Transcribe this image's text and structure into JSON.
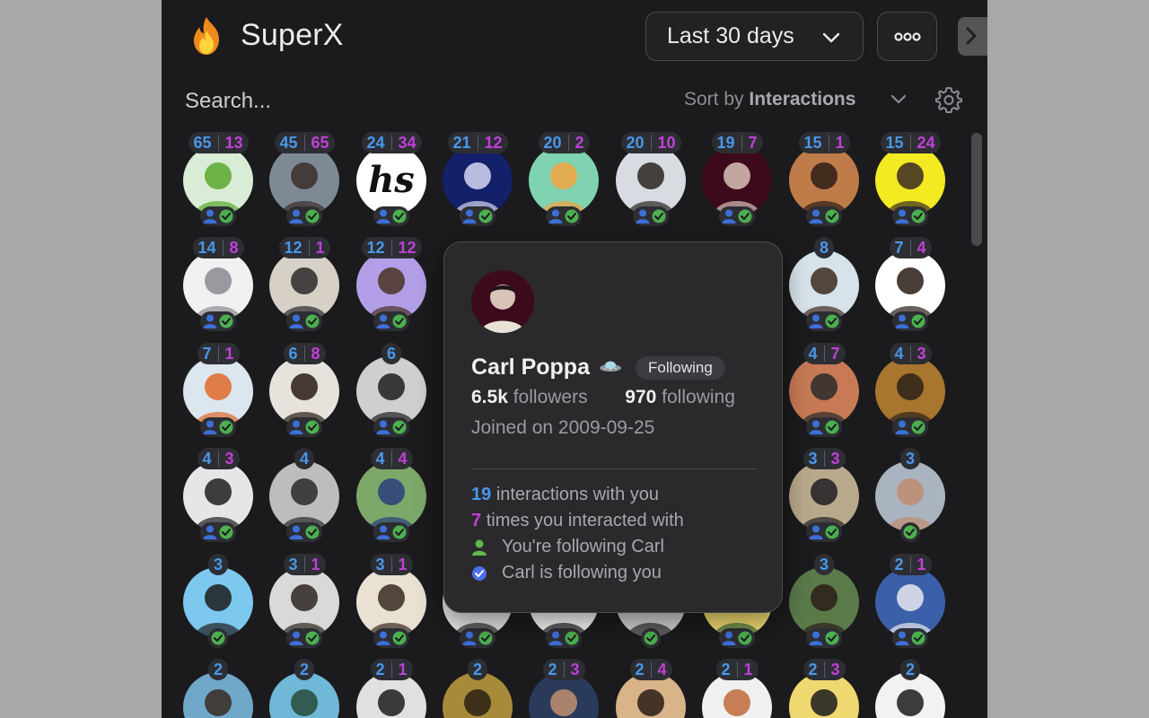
{
  "header": {
    "app_title": "SuperX",
    "date_range": "Last 30 days",
    "more_icon": "more-horizontal-icon",
    "collapse_icon": "chevron-right-icon"
  },
  "search": {
    "placeholder": "Search..."
  },
  "sort": {
    "prefix": "Sort by",
    "value": "Interactions"
  },
  "colors": {
    "background": "#1b1b1d",
    "interactions_with_you": "#4a97ea",
    "you_interacted": "#c040d8",
    "following_badge": "#4a97ea",
    "follower_badge": "#4caf50"
  },
  "users": [
    {
      "a": "65",
      "b": "13",
      "bg": "#d8ecd6",
      "fg": "#5aa82d",
      "you": true,
      "them": true
    },
    {
      "a": "45",
      "b": "65",
      "bg": "#7d8a96",
      "fg": "#3a2e2a",
      "you": true,
      "them": true
    },
    {
      "a": "24",
      "b": "34",
      "bg": "#ffffff",
      "fg": "#111111",
      "text": "hs",
      "you": true,
      "them": true
    },
    {
      "a": "21",
      "b": "12",
      "bg": "#13206a",
      "fg": "#d7d8f2",
      "you": true,
      "them": true
    },
    {
      "a": "20",
      "b": "2",
      "bg": "#7fd3b1",
      "fg": "#f2a342",
      "you": true,
      "them": true
    },
    {
      "a": "20",
      "b": "10",
      "bg": "#d8dce2",
      "fg": "#2a2520",
      "you": true,
      "them": true
    },
    {
      "a": "19",
      "b": "7",
      "bg": "#3d0a1c",
      "fg": "#d9c2b6",
      "you": true,
      "them": true
    },
    {
      "a": "15",
      "b": "1",
      "bg": "#bf7b48",
      "fg": "#2d1e18",
      "you": true,
      "them": true
    },
    {
      "a": "15",
      "b": "24",
      "bg": "#f3ea22",
      "fg": "#3a2a22",
      "you": true,
      "them": true
    },
    {
      "a": "14",
      "b": "8",
      "bg": "#f1f1f1",
      "fg": "#8a8a92",
      "you": true,
      "them": true
    },
    {
      "a": "12",
      "b": "1",
      "bg": "#d6d0c6",
      "fg": "#2a2a2a",
      "you": true,
      "them": true
    },
    {
      "a": "12",
      "b": "12",
      "bg": "#b39ee8",
      "fg": "#4a3222",
      "you": true,
      "them": true
    },
    {
      "a": "",
      "b": "",
      "bg": "#2a2a2d",
      "fg": "#2a2a2d",
      "hidden": true
    },
    {
      "a": "",
      "b": "",
      "bg": "#2a2a2d",
      "fg": "#2a2a2d",
      "hidden": true
    },
    {
      "a": "",
      "b": "",
      "bg": "#2a2a2d",
      "fg": "#2a2a2d",
      "hidden": true
    },
    {
      "a": "",
      "b": "",
      "bg": "#2a2a2d",
      "fg": "#2a2a2d",
      "hidden": true
    },
    {
      "a": "8",
      "b": "",
      "bg": "#d7e3ea",
      "fg": "#3d2a20",
      "you": true,
      "them": true
    },
    {
      "a": "7",
      "b": "4",
      "bg": "#ffffff",
      "fg": "#2a1c16",
      "you": true,
      "them": true
    },
    {
      "a": "7",
      "b": "1",
      "bg": "#dbe6ee",
      "fg": "#e0682a",
      "you": true,
      "them": true
    },
    {
      "a": "6",
      "b": "8",
      "bg": "#e7e3dc",
      "fg": "#2a1c16",
      "you": true,
      "them": true
    },
    {
      "a": "6",
      "b": "",
      "bg": "#cfcfcf",
      "fg": "#1e1e1e",
      "you": true,
      "them": true
    },
    {
      "a": "",
      "b": "",
      "bg": "#2a2a2d",
      "fg": "#2a2a2d",
      "hidden": true
    },
    {
      "a": "",
      "b": "",
      "bg": "#2a2a2d",
      "fg": "#2a2a2d",
      "hidden": true
    },
    {
      "a": "",
      "b": "",
      "bg": "#2a2a2d",
      "fg": "#2a2a2d",
      "hidden": true
    },
    {
      "a": "",
      "b": "",
      "bg": "#2a2a2d",
      "fg": "#2a2a2d",
      "hidden": true
    },
    {
      "a": "4",
      "b": "7",
      "bg": "#c77a55",
      "fg": "#2a2a2a",
      "you": true,
      "them": true
    },
    {
      "a": "4",
      "b": "3",
      "bg": "#a8762e",
      "fg": "#2b2219",
      "you": true,
      "them": true
    },
    {
      "a": "4",
      "b": "3",
      "bg": "#e6e6e6",
      "fg": "#1e1e1e",
      "you": true,
      "them": true
    },
    {
      "a": "4",
      "b": "",
      "bg": "#bdbdbd",
      "fg": "#2a2a2a",
      "you": true,
      "them": true
    },
    {
      "a": "4",
      "b": "4",
      "bg": "#7ea86a",
      "fg": "#2a3e7a",
      "you": true,
      "them": true
    },
    {
      "a": "",
      "b": "",
      "bg": "#2a2a2d",
      "fg": "#2a2a2d",
      "hidden": true
    },
    {
      "a": "",
      "b": "",
      "bg": "#2a2a2d",
      "fg": "#2a2a2d",
      "hidden": true
    },
    {
      "a": "",
      "b": "",
      "bg": "#2a2a2d",
      "fg": "#2a2a2d",
      "hidden": true
    },
    {
      "a": "",
      "b": "",
      "bg": "#2a2a2d",
      "fg": "#2a2a2d",
      "hidden": true
    },
    {
      "a": "3",
      "b": "3",
      "bg": "#b9a98c",
      "fg": "#1f1f22",
      "you": true,
      "them": true
    },
    {
      "a": "3",
      "b": "",
      "bg": "#aab4c0",
      "fg": "#c08c70",
      "you": false,
      "them": true
    },
    {
      "a": "3",
      "b": "",
      "bg": "#7cc8ef",
      "fg": "#1c1c1c",
      "you": false,
      "them": true
    },
    {
      "a": "3",
      "b": "1",
      "bg": "#d9d9d9",
      "fg": "#2d2520",
      "you": true,
      "them": true
    },
    {
      "a": "3",
      "b": "1",
      "bg": "#e9e2d2",
      "fg": "#3a2a22",
      "ring": "#a23bd4",
      "you": true,
      "them": true
    },
    {
      "a": "",
      "b": "",
      "bg": "#e2e2e2",
      "fg": "#2a2a2a",
      "partial": true,
      "you": true,
      "them": true
    },
    {
      "a": "",
      "b": "",
      "bg": "#f3f3f3",
      "fg": "#1c1c1c",
      "partial": true,
      "you": true,
      "them": true
    },
    {
      "a": "",
      "b": "",
      "bg": "#cfcfcf",
      "fg": "#2a2a2a",
      "partial": true,
      "you": false,
      "them": true
    },
    {
      "a": "",
      "b": "",
      "bg": "#f0d870",
      "fg": "#3a6a3a",
      "partial": true,
      "you": true,
      "them": true
    },
    {
      "a": "3",
      "b": "",
      "bg": "#5a7a4a",
      "fg": "#2a1e18",
      "you": true,
      "them": true
    },
    {
      "a": "2",
      "b": "1",
      "bg": "#3b5fa8",
      "fg": "#e8e8f0",
      "you": true,
      "them": true
    },
    {
      "a": "2",
      "b": "",
      "bg": "#6fa8c8",
      "fg": "#3a2a22",
      "you": false,
      "them": false
    },
    {
      "a": "2",
      "b": "",
      "bg": "#6fb8d8",
      "fg": "#2a4a3a",
      "you": false,
      "them": false
    },
    {
      "a": "2",
      "b": "1",
      "bg": "#e0e0e0",
      "fg": "#1c1c1c",
      "you": false,
      "them": false
    },
    {
      "a": "2",
      "b": "",
      "bg": "#a88a3a",
      "fg": "#2a2214",
      "you": false,
      "them": false
    },
    {
      "a": "2",
      "b": "3",
      "bg": "#2a3a5a",
      "fg": "#c09070",
      "you": false,
      "them": false
    },
    {
      "a": "2",
      "b": "4",
      "bg": "#d8b488",
      "fg": "#2a1c16",
      "you": false,
      "them": false
    },
    {
      "a": "2",
      "b": "1",
      "bg": "#f0f0f0",
      "fg": "#c06a3a",
      "you": false,
      "them": false
    },
    {
      "a": "2",
      "b": "3",
      "bg": "#f0d870",
      "fg": "#1c1c1c",
      "you": false,
      "them": false
    },
    {
      "a": "2",
      "b": "",
      "bg": "#f2f2f2",
      "fg": "#1c1c1c",
      "you": false,
      "them": false
    }
  ],
  "tooltip": {
    "name": "Carl Poppa",
    "name_emoji": "ufo-icon",
    "badge": "Following",
    "followers_count": "6.5k",
    "followers_label": "followers",
    "following_count": "970",
    "following_label": "following",
    "joined": "Joined on 2009-09-25",
    "interactions_count": "19",
    "interactions_label": "interactions with you",
    "you_interacted_count": "7",
    "you_interacted_label": "times you interacted with",
    "following_line": "You're following Carl",
    "follower_line": "Carl is following you"
  }
}
